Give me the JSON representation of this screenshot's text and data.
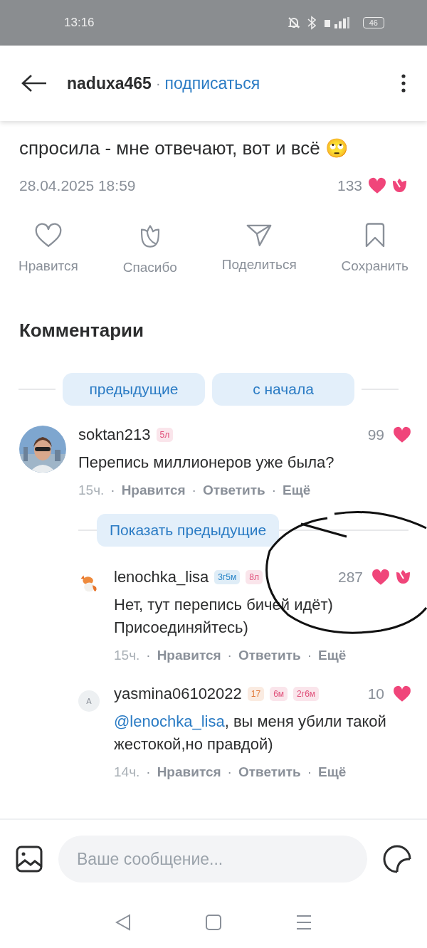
{
  "status_bar": {
    "time": "13:16",
    "battery": "46"
  },
  "header": {
    "username": "naduxa465",
    "separator": "·",
    "subscribe": "подписаться"
  },
  "post": {
    "lines": [
      "спросила - мне отвечают, вот и всё 🙄"
    ],
    "date": "28.04.2025 18:59",
    "count": "133",
    "thanked": true
  },
  "actions": [
    {
      "kind": "like",
      "label": "Нравится"
    },
    {
      "kind": "thanks",
      "label": "Спасибо"
    },
    {
      "kind": "share",
      "label": "Поделиться"
    },
    {
      "kind": "save",
      "label": "Сохранить"
    }
  ],
  "comments_title": "Комментарии",
  "pager": [
    "предыдущие",
    "с начала"
  ],
  "comments": [
    {
      "user": "soktan213",
      "badges": [
        {
          "text": "5л",
          "color": "#e0507a"
        }
      ],
      "likes": "99",
      "thanked": false,
      "text": "Перепись миллионеров уже была?",
      "time": "15ч.",
      "links": [
        "Нравится",
        "Ответить",
        "Ещё"
      ]
    }
  ],
  "show_previous": "Показать предыдущие",
  "replies": [
    {
      "user": "lenochka_lisa",
      "badges": [
        {
          "text": "3г5м",
          "color": "#2a86c8"
        },
        {
          "text": "8л",
          "color": "#e0507a"
        }
      ],
      "likes": "287",
      "thanked": true,
      "text": "Нет, тут перепись бичей идёт)\nПрисоединяйтесь)",
      "time": "15ч.",
      "links": [
        "Нравится",
        "Ответить",
        "Ещё"
      ]
    },
    {
      "letter": "A",
      "user": "yasmina06102022",
      "badges": [
        {
          "text": "17",
          "color": "#e07a3a"
        },
        {
          "text": "6м",
          "color": "#e0507a"
        },
        {
          "text": "2г6м",
          "color": "#e0507a"
        }
      ],
      "likes": "10",
      "thanked": false,
      "mention": "@lenochka_lisa",
      "text": ", вы меня убили такой жестокой,но правдой)",
      "time": "14ч.",
      "links": [
        "Нравится",
        "Ответить",
        "Ещё"
      ]
    }
  ],
  "link_separator": "·",
  "composer": {
    "placeholder": "Ваше сообщение..."
  }
}
